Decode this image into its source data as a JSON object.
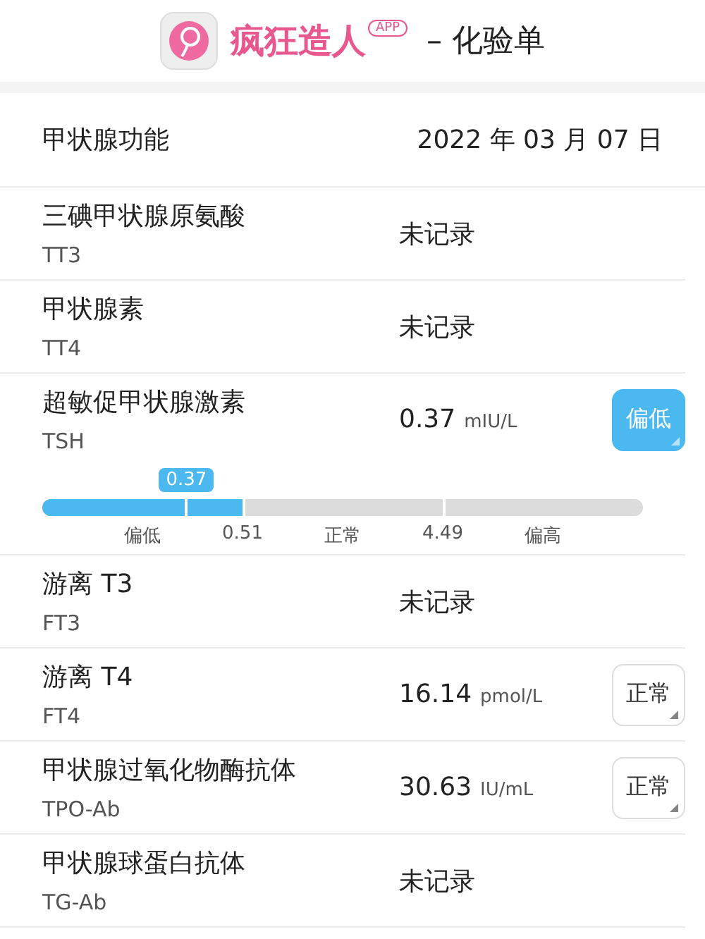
{
  "header": {
    "brand": "疯狂造人",
    "badge": "APP",
    "title": "– 化验单"
  },
  "section": {
    "title": "甲状腺功能",
    "date": "2022 年 03 月 07 日"
  },
  "rows": [
    {
      "kind": "empty",
      "name": "三碘甲状腺原氨酸",
      "code": "TT3",
      "value": "未记录"
    },
    {
      "kind": "empty",
      "name": "甲状腺素",
      "code": "TT4",
      "value": "未记录"
    },
    {
      "kind": "value",
      "name": "超敏促甲状腺激素",
      "code": "TSH",
      "value": "0.37",
      "unit": "mIU/L",
      "status": {
        "kind": "low",
        "label": "偏低"
      },
      "gauge": {
        "marker": "0.37",
        "level": 0.24,
        "limits": [
          "0.51",
          "4.49"
        ],
        "segments": [
          {
            "label": "偏低",
            "selected": true
          },
          {
            "label": "正常",
            "selected": false
          },
          {
            "label": "偏高",
            "selected": false
          }
        ]
      }
    },
    {
      "kind": "empty",
      "name": "游离 T3",
      "code": "FT3",
      "value": "未记录"
    },
    {
      "kind": "value",
      "name": "游离 T4",
      "code": "FT4",
      "value": "16.14",
      "unit": "pmol/L",
      "status": {
        "kind": "normal",
        "label": "正常"
      }
    },
    {
      "kind": "value",
      "name": "甲状腺过氧化物酶抗体",
      "code": "TPO-Ab",
      "value": "30.63",
      "unit": "IU/mL",
      "status": {
        "kind": "normal",
        "label": "正常"
      }
    },
    {
      "kind": "empty",
      "name": "甲状腺球蛋白抗体",
      "code": "TG-Ab",
      "value": "未记录"
    }
  ]
}
